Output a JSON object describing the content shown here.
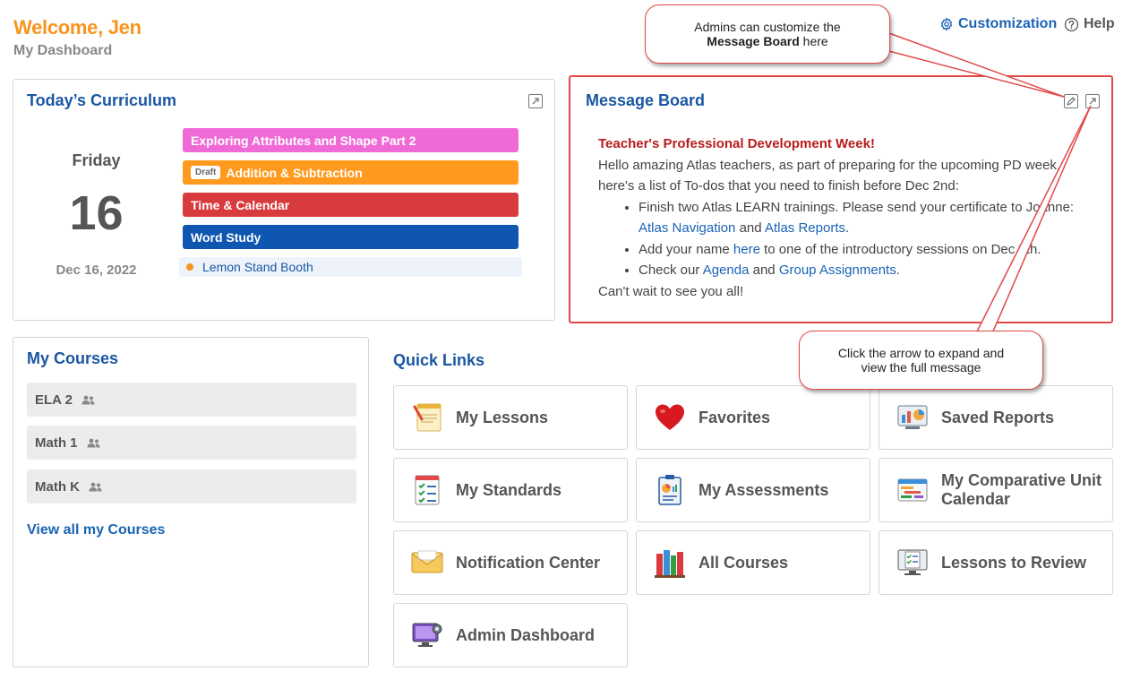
{
  "header": {
    "welcome": "Welcome, Jen",
    "subtitle": "My Dashboard",
    "customization_label": "Customization",
    "help_label": "Help"
  },
  "curriculum": {
    "title": "Today’s Curriculum",
    "day_name": "Friday",
    "day_number": "16",
    "date": "Dec 16, 2022",
    "lessons": [
      {
        "label": "Exploring Attributes and Shape Part 2",
        "color": "#f06ad7",
        "badge": ""
      },
      {
        "label": "Addition & Subtraction",
        "color": "#ff9a1f",
        "badge": "Draft"
      },
      {
        "label": "Time & Calendar",
        "color": "#d83b3e",
        "badge": ""
      },
      {
        "label": "Word Study",
        "color": "#0e56b0",
        "badge": ""
      }
    ],
    "event": {
      "label": "Lemon Stand Booth",
      "dot_color": "#f7941d"
    }
  },
  "message_board": {
    "title": "Message Board",
    "heading": "Teacher's Professional Development Week!",
    "intro": "Hello amazing Atlas teachers, as part of preparing for the upcoming PD week, here's a list of To-dos that you need to finish before Dec 2nd:",
    "item1_text": "Finish two Atlas LEARN trainings. Please send your certificate to Joanne:",
    "item1_link1": "Atlas Navigation",
    "item1_and": "and",
    "item1_link2": "Atlas Reports",
    "item2_pre": "Add your name",
    "item2_link": "here",
    "item2_post": "to one of the introductory sessions on Dec 5th.",
    "item3_pre": "Check our",
    "item3_link1": "Agenda",
    "item3_and": "and",
    "item3_link2": "Group Assignments",
    "closing": "Can't wait to see you all!"
  },
  "my_courses": {
    "title": "My Courses",
    "courses": [
      "ELA 2",
      "Math 1",
      "Math K"
    ],
    "view_all": "View all my Courses"
  },
  "quick_links": {
    "title": "Quick Links",
    "tiles": [
      {
        "label": "My Lessons",
        "icon": "lesson-planning-icon"
      },
      {
        "label": "Favorites",
        "icon": "heart-icon"
      },
      {
        "label": "Saved Reports",
        "icon": "report-chart-icon"
      },
      {
        "label": "My Standards",
        "icon": "checklist-icon"
      },
      {
        "label": "My Assessments",
        "icon": "clipboard-chart-icon"
      },
      {
        "label": "My Comparative Unit Calendar",
        "icon": "calendar-bars-icon"
      },
      {
        "label": "Notification Center",
        "icon": "envelope-icon"
      },
      {
        "label": "All Courses",
        "icon": "books-icon"
      },
      {
        "label": "Lessons to Review",
        "icon": "monitor-checklist-icon"
      },
      {
        "label": "Admin Dashboard",
        "icon": "admin-monitor-icon"
      }
    ]
  },
  "callouts": {
    "top_line1": "Admins can customize the",
    "top_bold": "Message Board",
    "top_after": "here",
    "bottom_line1": "Click the arrow to expand and",
    "bottom_line2": "view the full message"
  },
  "colors": {
    "accent_orange": "#f7941d",
    "brand_blue": "#1a57a3",
    "highlight_red": "#e24848"
  }
}
